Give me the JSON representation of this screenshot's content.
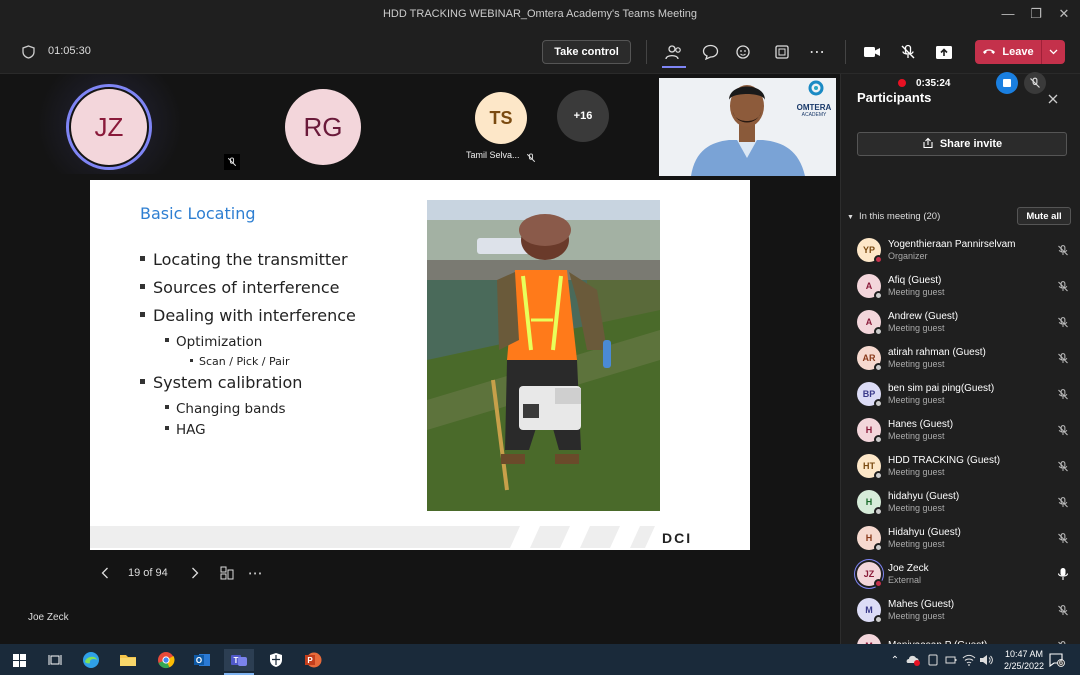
{
  "window": {
    "title": "HDD TRACKING WEBINAR_Omtera Academy's Teams Meeting"
  },
  "toolbar": {
    "timer": "01:05:30",
    "take_control": "Take control",
    "leave": "Leave"
  },
  "recording": {
    "time": "0:35:24"
  },
  "tiles": [
    {
      "initials": "JZ",
      "bg": "#f3d6db",
      "fg": "#8a1a3a"
    },
    {
      "initials": "RG",
      "bg": "#f3d6db",
      "fg": "#6a1a3a"
    },
    {
      "initials": "TS",
      "bg": "#fde7c8",
      "fg": "#7a4a10",
      "name": "Tamil Selva..."
    },
    {
      "initials": "+16"
    }
  ],
  "video": {
    "logo_text": "OMTERA",
    "logo_sub": "ACADEMY"
  },
  "slide": {
    "title": "Basic Locating",
    "bullets": [
      {
        "level": 1,
        "text": "Locating the transmitter"
      },
      {
        "level": 1,
        "text": "Sources of interference"
      },
      {
        "level": 1,
        "text": "Dealing with interference"
      },
      {
        "level": 2,
        "text": "Optimization"
      },
      {
        "level": 3,
        "text": "Scan / Pick / Pair"
      },
      {
        "level": 1,
        "text": "System calibration"
      },
      {
        "level": 2,
        "text": "Changing bands"
      },
      {
        "level": 2,
        "text": "HAG"
      }
    ],
    "logo": "DCI"
  },
  "slide_nav": {
    "counter": "19 of 94"
  },
  "presenter": {
    "name": "Joe Zeck"
  },
  "side_panel": {
    "title": "Participants",
    "share_invite": "Share invite",
    "section": "In this meeting (20)",
    "mute_all": "Mute all",
    "participants": [
      {
        "initials": "YP",
        "name": "Yogenthieraan Pannirselvam",
        "role": "Organizer",
        "bg": "#fde7c8",
        "fg": "#7a4a10",
        "dot": "#c4314b",
        "mic": "muted"
      },
      {
        "initials": "A",
        "name": "Afiq (Guest)",
        "role": "Meeting guest",
        "bg": "#f3d6db",
        "fg": "#8a1a3a",
        "dot": "#ccc",
        "mic": "muted"
      },
      {
        "initials": "A",
        "name": "Andrew (Guest)",
        "role": "Meeting guest",
        "bg": "#f3d6db",
        "fg": "#8a1a3a",
        "dot": "#ccc",
        "mic": "muted"
      },
      {
        "initials": "AR",
        "name": "atirah rahman (Guest)",
        "role": "Meeting guest",
        "bg": "#f6d9cf",
        "fg": "#8a3a1a",
        "dot": "#ccc",
        "mic": "muted"
      },
      {
        "initials": "BP",
        "name": "ben sim pai ping(Guest)",
        "role": "Meeting guest",
        "bg": "#dcdcf6",
        "fg": "#3a3a8a",
        "dot": "#ccc",
        "mic": "muted"
      },
      {
        "initials": "H",
        "name": "Hanes (Guest)",
        "role": "Meeting guest",
        "bg": "#f3d6db",
        "fg": "#8a1a3a",
        "dot": "#ccc",
        "mic": "muted"
      },
      {
        "initials": "HT",
        "name": "HDD TRACKING (Guest)",
        "role": "Meeting guest",
        "bg": "#fde7c8",
        "fg": "#7a4a10",
        "dot": "#ccc",
        "mic": "muted"
      },
      {
        "initials": "H",
        "name": "hidahyu (Guest)",
        "role": "Meeting guest",
        "bg": "#d6ecd9",
        "fg": "#1a6a2a",
        "dot": "#ccc",
        "mic": "muted"
      },
      {
        "initials": "H",
        "name": "Hidahyu (Guest)",
        "role": "Meeting guest",
        "bg": "#f6d9cf",
        "fg": "#8a3a1a",
        "dot": "#ccc",
        "mic": "muted"
      },
      {
        "initials": "JZ",
        "name": "Joe Zeck",
        "role": "External",
        "bg": "#f3d6db",
        "fg": "#8a1a3a",
        "dot": "#c4314b",
        "mic": "on"
      },
      {
        "initials": "M",
        "name": "Mahes (Guest)",
        "role": "Meeting guest",
        "bg": "#dcdcf6",
        "fg": "#3a3a8a",
        "dot": "#ccc",
        "mic": "muted"
      },
      {
        "initials": "M",
        "name": "Manivaasan.P (Guest)",
        "role": "",
        "bg": "#f3d6db",
        "fg": "#8a1a3a",
        "dot": "#ccc",
        "mic": "muted"
      }
    ]
  },
  "taskbar": {
    "time": "10:47 AM",
    "date": "2/25/2022",
    "notifications": "6"
  }
}
